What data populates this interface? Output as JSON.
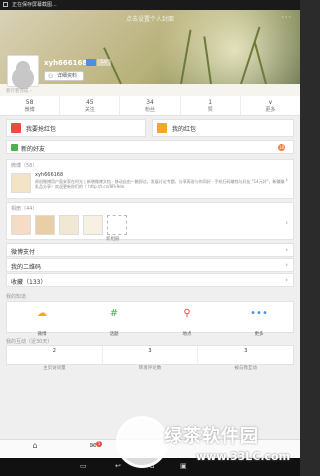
{
  "status_bar": {
    "text": "正在保存屏幕截图..."
  },
  "cover": {
    "hint": "点击设置个人封面",
    "more": "···"
  },
  "profile": {
    "username": "xyh666168",
    "level_badge": "Lv",
    "detail_button": "详细资料",
    "verify_tip": "新行客完成 ›"
  },
  "stats": [
    {
      "num": "58",
      "label": "微博"
    },
    {
      "num": "45",
      "label": "关注"
    },
    {
      "num": "34",
      "label": "粉丝"
    },
    {
      "num": "1",
      "label": "赞"
    },
    {
      "num": "∨",
      "label": "更多"
    }
  ],
  "red_packets": {
    "grab": "我要抢红包",
    "mine": "我的红包"
  },
  "friends": {
    "label": "新的好友",
    "badge": "18"
  },
  "weibo": {
    "header": "微博（58）",
    "author": "xyh666168",
    "excerpt": "原创微博用户面安家在时光 | 新增微博文档 · 移动自由一触即达，发展讨论专题，分享再说与你同好 · 手机扫码赚钱与好友 \"14元好\"，新赚赚乳品分享！欢迎更新你们的 ！http://t.cn/8Fk9de"
  },
  "photos": {
    "header": "相册（44）",
    "new_label": "新相册"
  },
  "menu_rows": [
    "微博支付",
    "我的二维码",
    "收藏（133）"
  ],
  "tools_section": "我的知道",
  "tools": [
    {
      "icon": "cloud-icon",
      "label": "微博"
    },
    {
      "icon": "hash-icon",
      "label": "话题"
    },
    {
      "icon": "location-icon",
      "label": "地点"
    },
    {
      "icon": "dots-icon",
      "label": "更多"
    }
  ],
  "interact_section": "我的互动（近30天）",
  "interact": [
    {
      "num": "2",
      "label": "主页访问量"
    },
    {
      "num": "3",
      "label": "转发评论数"
    },
    {
      "num": "3",
      "label": "被与我互动"
    }
  ],
  "nav": [
    {
      "icon": "home-icon",
      "label": "首页"
    },
    {
      "icon": "message-icon",
      "label": "消息"
    }
  ],
  "nav_badge": "5",
  "watermark": {
    "text": "绿茶软件园",
    "url": "www.33LC.com"
  },
  "colors": {
    "accent": "#f07a3c",
    "red": "#e94b3c",
    "orange": "#f5a623",
    "green": "#4cae4c",
    "blue": "#4a90e2"
  }
}
